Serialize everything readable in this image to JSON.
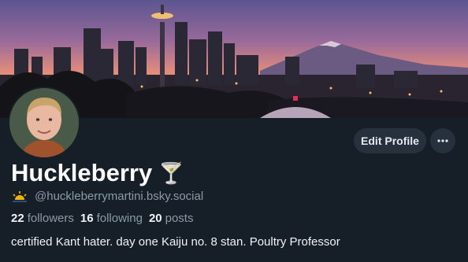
{
  "profile": {
    "display_name": "Huckleberry",
    "name_emoji": "🍸",
    "handle": "@huckleberrymartini.bsky.social",
    "handle_icon": "sunrise-icon",
    "followers_count": "22",
    "followers_label": "followers",
    "following_count": "16",
    "following_label": "following",
    "posts_count": "20",
    "posts_label": "posts",
    "bio": "certified Kant hater. day one Kaiju no. 8 stan. Poultry Professor"
  },
  "actions": {
    "edit_label": "Edit Profile",
    "more_icon": "ellipsis-icon"
  },
  "banner": {
    "description_icon": "city-skyline-image"
  },
  "colors": {
    "background": "#161e27",
    "button_bg": "#26313d",
    "muted_text": "#8c9aa8",
    "primary_text": "#f1f3f5"
  }
}
